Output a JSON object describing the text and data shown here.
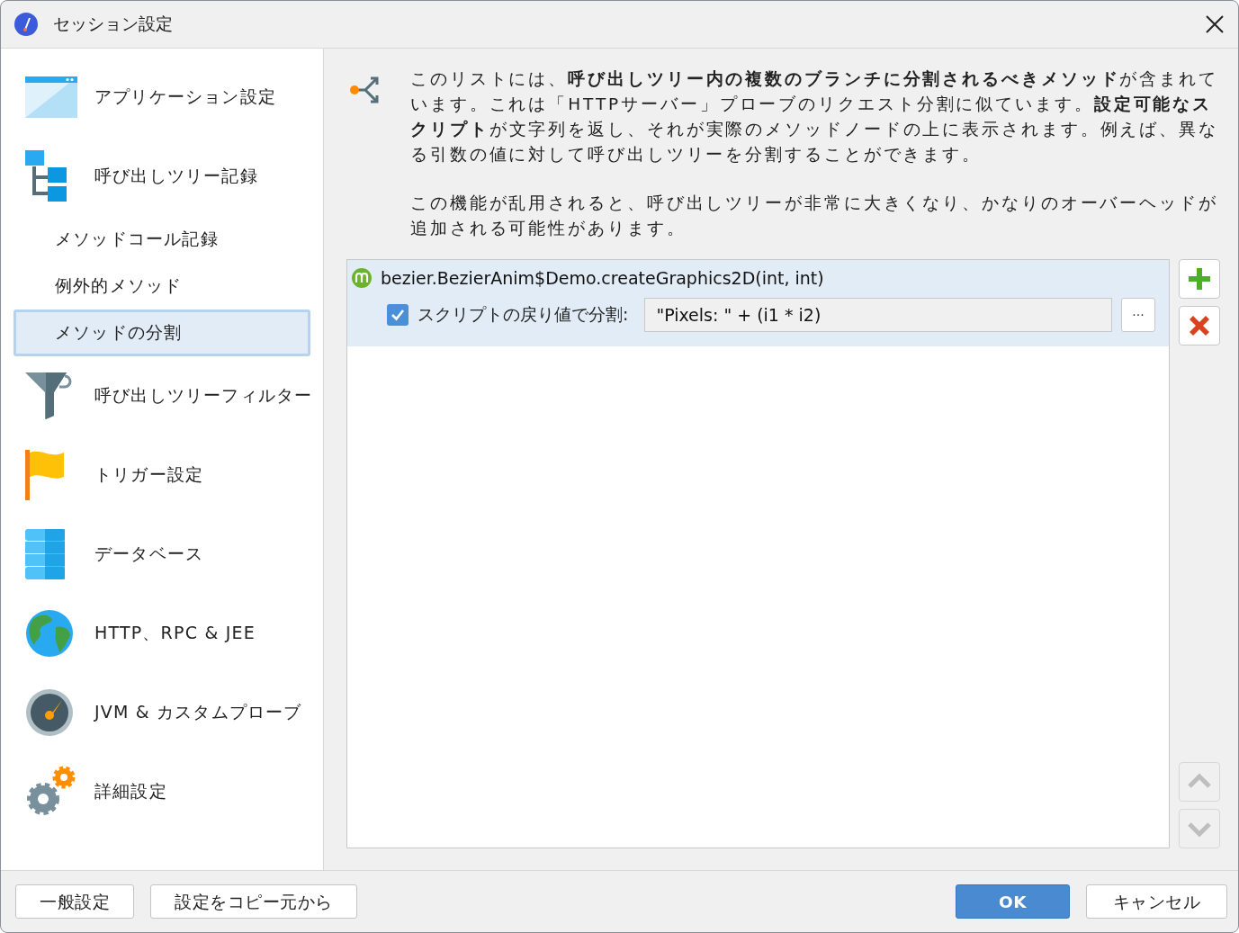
{
  "window": {
    "title": "セッション設定"
  },
  "sidebar": {
    "items": [
      {
        "kind": "main",
        "label": "アプリケーション設定",
        "selected": false
      },
      {
        "kind": "main",
        "label": "呼び出しツリー記録",
        "selected": false
      },
      {
        "kind": "sub",
        "label": "メソッドコール記録",
        "selected": false
      },
      {
        "kind": "sub",
        "label": "例外的メソッド",
        "selected": false
      },
      {
        "kind": "sub",
        "label": "メソッドの分割",
        "selected": true
      },
      {
        "kind": "main",
        "label": "呼び出しツリーフィルター",
        "selected": false
      },
      {
        "kind": "main",
        "label": "トリガー設定",
        "selected": false
      },
      {
        "kind": "main",
        "label": "データベース",
        "selected": false
      },
      {
        "kind": "main",
        "label": "HTTP、RPC & JEE",
        "selected": false
      },
      {
        "kind": "main",
        "label": "JVM & カスタムプローブ",
        "selected": false
      },
      {
        "kind": "main",
        "label": "詳細設定",
        "selected": false
      }
    ]
  },
  "description": {
    "paragraphs": [
      "このリストには、**呼び出しツリー内の複数のブランチに分割されるべきメソッド**が含まれています。これは「HTTPサーバー」プローブのリクエスト分割に似ています。**設定可能なスクリプト**が文字列を返し、それが実際のメソッドノードの上に表示されます。例えば、異なる引数の値に対して呼び出しツリーを分割することができます。",
      "この機能が乱用されると、呼び出しツリーが非常に大きくなり、かなりのオーバーヘッドが追加される可能性があります。"
    ]
  },
  "methods": [
    {
      "name": "bezier.BezierAnim$Demo.createGraphics2D(int, int)",
      "selected": true,
      "split": {
        "checked": true,
        "label": "スクリプトの戻り値で分割:",
        "value": "\"Pixels: \" + (i1 * i2)",
        "browse": "···"
      }
    }
  ],
  "side_buttons": [
    {
      "kind": "add",
      "disabled": false
    },
    {
      "kind": "remove",
      "disabled": false
    },
    {
      "kind": "up",
      "disabled": true
    },
    {
      "kind": "down",
      "disabled": true
    }
  ],
  "footer": {
    "left_buttons": [
      "一般設定",
      "設定をコピー元から"
    ],
    "ok": "OK",
    "cancel": "キャンセル"
  }
}
